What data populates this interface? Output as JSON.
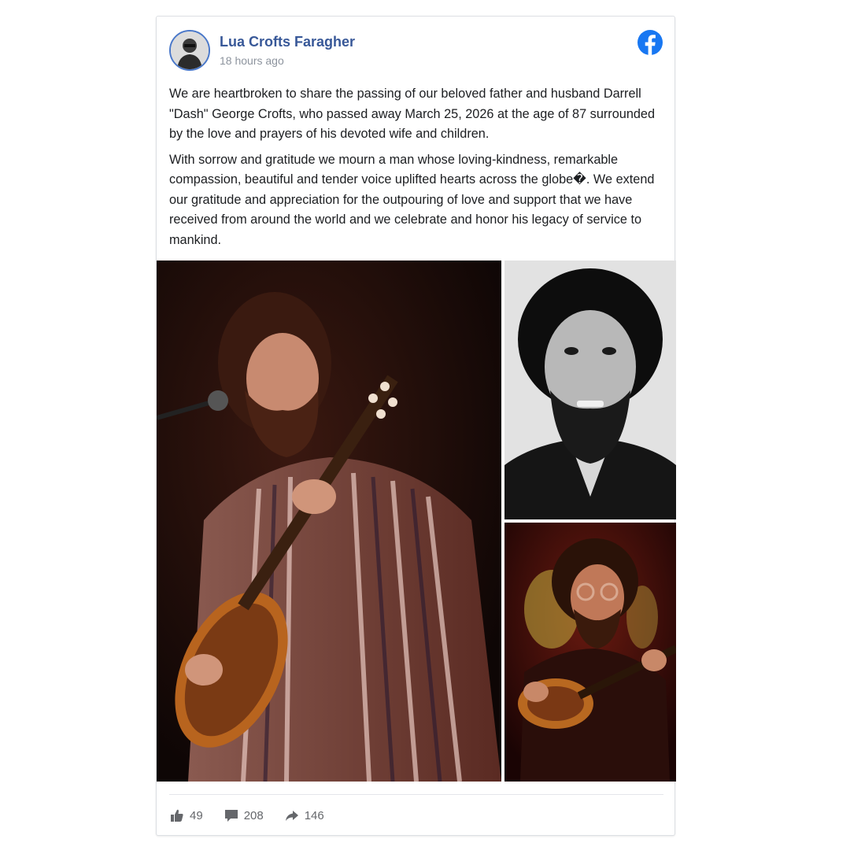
{
  "post": {
    "author": "Lua Crofts Faragher",
    "timestamp": "18 hours ago",
    "paragraphs": [
      "We are heartbroken to share the passing of our beloved father and husband Darrell \"Dash\" George Crofts, who passed away March 25, 2026 at the age of 87 surrounded by the love and prayers of his devoted wife and children.",
      "With sorrow and gratitude we mourn a man whose loving-kindness, remarkable compassion, beautiful and tender voice uplifted hearts across the globe�. We extend our gratitude and appreciation for the outpouring of love and support that we have received from around the world and we celebrate and honor his legacy of service to mankind."
    ]
  },
  "photos": [
    {
      "description": "man with beard playing mandolin at microphone, red-toned stage photo"
    },
    {
      "description": "black and white portrait of bearded man"
    },
    {
      "description": "man with glasses playing mandolin on stage, red lighting"
    }
  ],
  "actions": {
    "likes": "49",
    "comments": "208",
    "shares": "146"
  },
  "icons": {
    "brand": "facebook-icon",
    "like": "thumbs-up-icon",
    "comment": "comment-icon",
    "share": "share-arrow-icon"
  },
  "colors": {
    "author_link": "#385898",
    "facebook_blue": "#1877f2",
    "muted_text": "#8d949e",
    "action_gray": "#65676b"
  }
}
